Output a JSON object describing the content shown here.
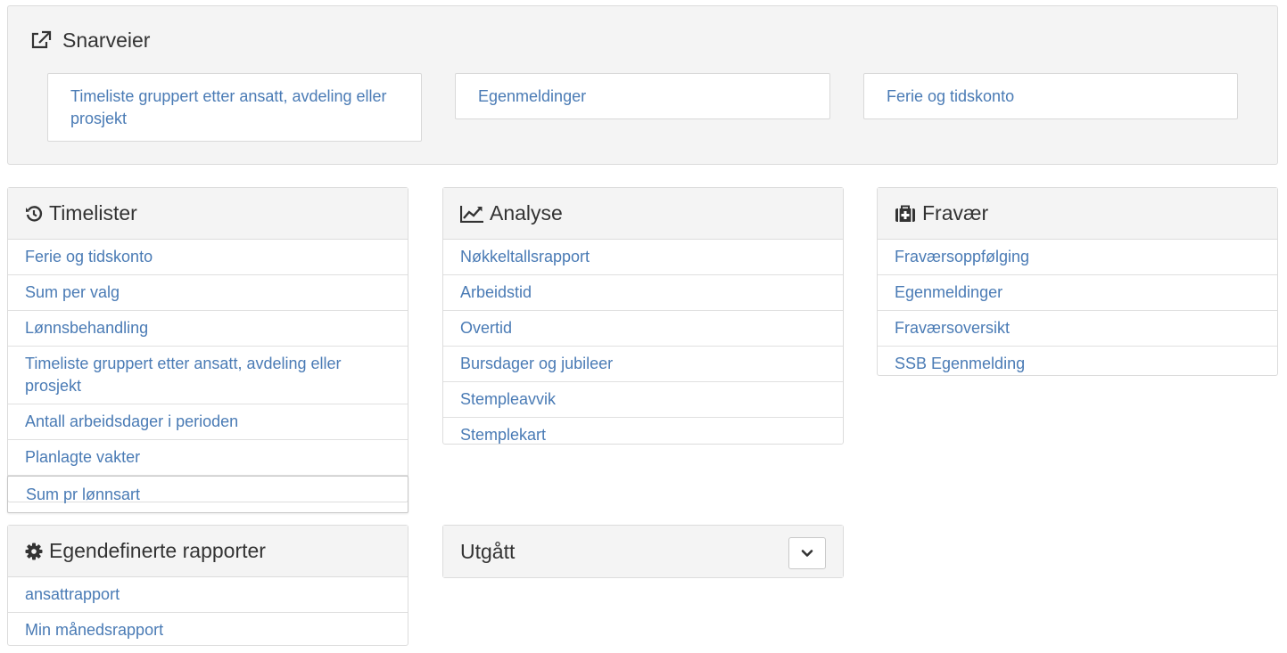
{
  "shortcuts": {
    "title": "Snarveier",
    "items": [
      {
        "label": "Timeliste gruppert etter ansatt, avdeling eller prosjekt"
      },
      {
        "label": "Egenmeldinger"
      },
      {
        "label": "Ferie og tidskonto"
      }
    ]
  },
  "timelister": {
    "title": "Timelister",
    "items": [
      {
        "label": "Ferie og tidskonto"
      },
      {
        "label": "Sum per valg"
      },
      {
        "label": "Lønnsbehandling"
      },
      {
        "label": "Timeliste gruppert etter ansatt, avdeling eller prosjekt"
      },
      {
        "label": "Antall arbeidsdager i perioden"
      },
      {
        "label": "Planlagte vakter"
      },
      {
        "label": "Sum pr lønnsart"
      }
    ]
  },
  "analyse": {
    "title": "Analyse",
    "items": [
      {
        "label": "Nøkkeltallsrapport"
      },
      {
        "label": "Arbeidstid"
      },
      {
        "label": "Overtid"
      },
      {
        "label": "Bursdager og jubileer"
      },
      {
        "label": "Stempleavvik"
      },
      {
        "label": "Stemplekart"
      }
    ]
  },
  "fravaer": {
    "title": "Fravær",
    "items": [
      {
        "label": "Fraværsoppfølging"
      },
      {
        "label": "Egenmeldinger"
      },
      {
        "label": "Fraværsoversikt"
      },
      {
        "label": "SSB Egenmelding"
      }
    ]
  },
  "egendefinerte": {
    "title": "Egendefinerte rapporter",
    "items": [
      {
        "label": "ansattrapport"
      },
      {
        "label": "Min månedsrapport"
      }
    ]
  },
  "utgatt": {
    "title": "Utgått"
  },
  "colors": {
    "link": "#4a7bb5",
    "header_bg": "#f4f4f4",
    "border": "#dcdcdc"
  },
  "icons": {
    "shortcuts": "external-link-icon",
    "timelister": "history-icon",
    "analyse": "line-chart-icon",
    "fravaer": "medkit-icon",
    "egendefinerte": "gear-icon",
    "utgatt_toggle": "chevron-down-icon"
  }
}
